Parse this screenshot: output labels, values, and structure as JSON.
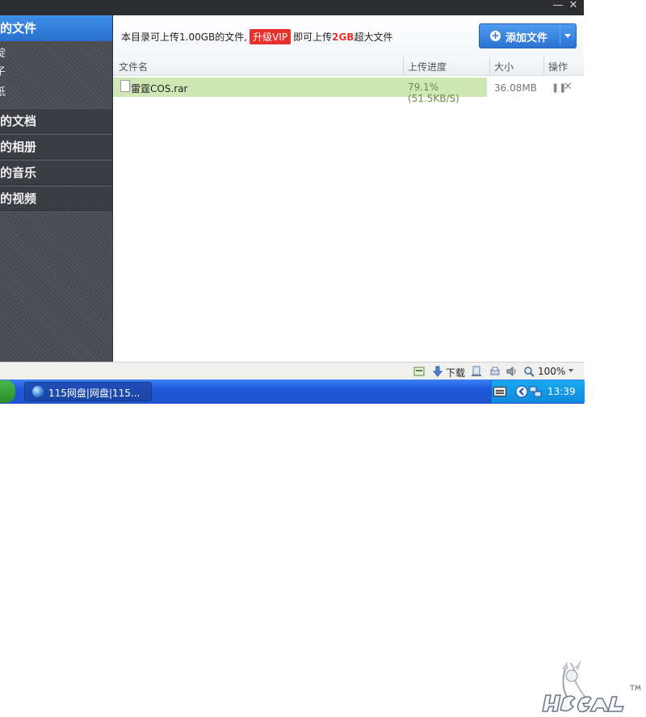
{
  "window": {
    "minimize_glyph": "—",
    "close_glyph": "✕"
  },
  "sidebar": {
    "active": "我的文件",
    "active_visible": "的文件",
    "subitems": [
      "绽",
      "子",
      "纸"
    ],
    "items": [
      {
        "label": "的文档"
      },
      {
        "label": "的相册"
      },
      {
        "label": "的音乐"
      },
      {
        "label": "的视频"
      }
    ]
  },
  "infobar": {
    "text_prefix": "本目录可上传1.00GB的文件,",
    "vip_label": "升级VIP",
    "text_mid": "即可上传",
    "highlight": "2GB",
    "text_suffix": "超大文件",
    "add_button": "添加文件"
  },
  "table": {
    "headers": {
      "name": "文件名",
      "progress": "上传进度",
      "size": "大小",
      "action": "操作"
    },
    "rows": [
      {
        "name": "雷霆COS.rar",
        "progress_text": "79.1%(51.5KB/S)",
        "progress": 0.791,
        "size": "36.08MB",
        "pause_glyph": "❚❚",
        "cancel_glyph": "✕"
      }
    ]
  },
  "statusbar": {
    "download_label": "下载",
    "zoom": "100%"
  },
  "taskbar": {
    "task_label": "115网盘|网盘|115...",
    "clock": "13:39"
  },
  "colors": {
    "accent_blue": "#2a72d4",
    "vip_red": "#e8312d",
    "progress_green": "#cfe7b5",
    "sidebar_bg": "#4a4c55"
  }
}
